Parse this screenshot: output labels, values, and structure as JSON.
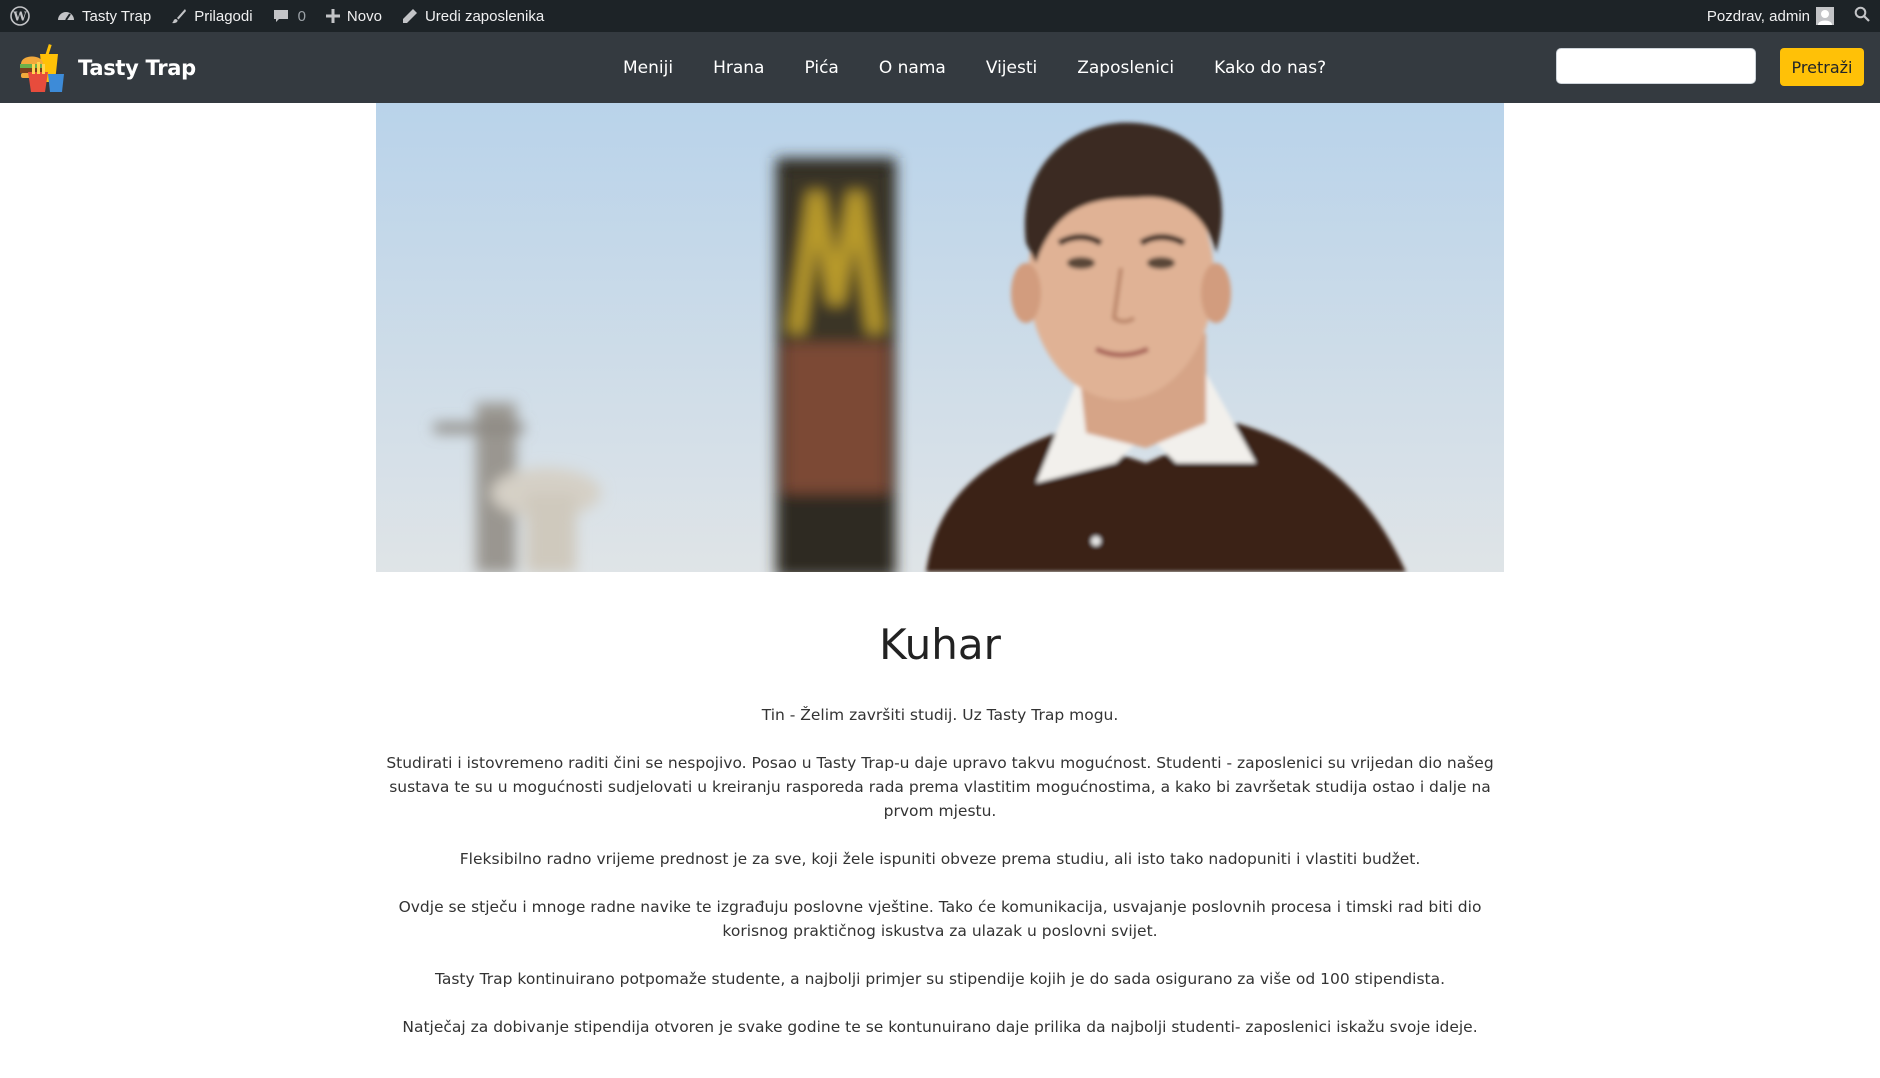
{
  "admin_bar": {
    "site_name": "Tasty Trap",
    "customize": "Prilagodi",
    "comments_count": "0",
    "new": "Novo",
    "edit": "Uredi zaposlenika",
    "greeting": "Pozdrav, admin"
  },
  "header": {
    "brand": "Tasty Trap",
    "nav": [
      "Meniji",
      "Hrana",
      "Pića",
      "O nama",
      "Vijesti",
      "Zaposlenici",
      "Kako do nas?"
    ],
    "search_placeholder": "",
    "search_button": "Pretraži"
  },
  "main": {
    "title": "Kuhar",
    "paragraphs": [
      "Tin - Želim završiti studij. Uz Tasty Trap mogu.",
      "Studirati i istovremeno raditi čini se nespojivo. Posao u Tasty Trap-u daje upravo takvu mogućnost. Studenti - zaposlenici su vrijedan dio našeg sustava te su u mogućnosti sudjelovati u kreiranju rasporeda rada prema vlastitim mogućnostima, a kako bi završetak studija ostao i dalje na prvom mjestu.",
      "Fleksibilno radno vrijeme prednost je za sve, koji žele ispuniti obveze prema studiu, ali isto tako nadopuniti i vlastiti budžet.",
      "Ovdje se stječu i mnoge radne navike te izgrađuju poslovne vještine. Tako će komunikacija, usvajanje poslovnih procesa i timski rad biti dio korisnog praktičnog iskustva za ulazak u poslovni svijet.",
      "Tasty Trap kontinuirano potpomaže studente, a najbolji primjer su stipendije kojih je do sada osigurano za više od 100 stipendista.",
      "Natječaj za dobivanje stipendija otvoren je svake godine te se kontunuirano daje prilika da najbolji studenti- zaposlenici iskažu svoje ideje."
    ]
  },
  "colors": {
    "admin_bar_bg": "#1d2327",
    "header_bg": "#343a40",
    "accent": "#ffc107"
  },
  "icons": [
    "wordpress-icon",
    "dashboard-icon",
    "brush-icon",
    "comment-icon",
    "plus-icon",
    "pencil-icon",
    "search-icon"
  ]
}
